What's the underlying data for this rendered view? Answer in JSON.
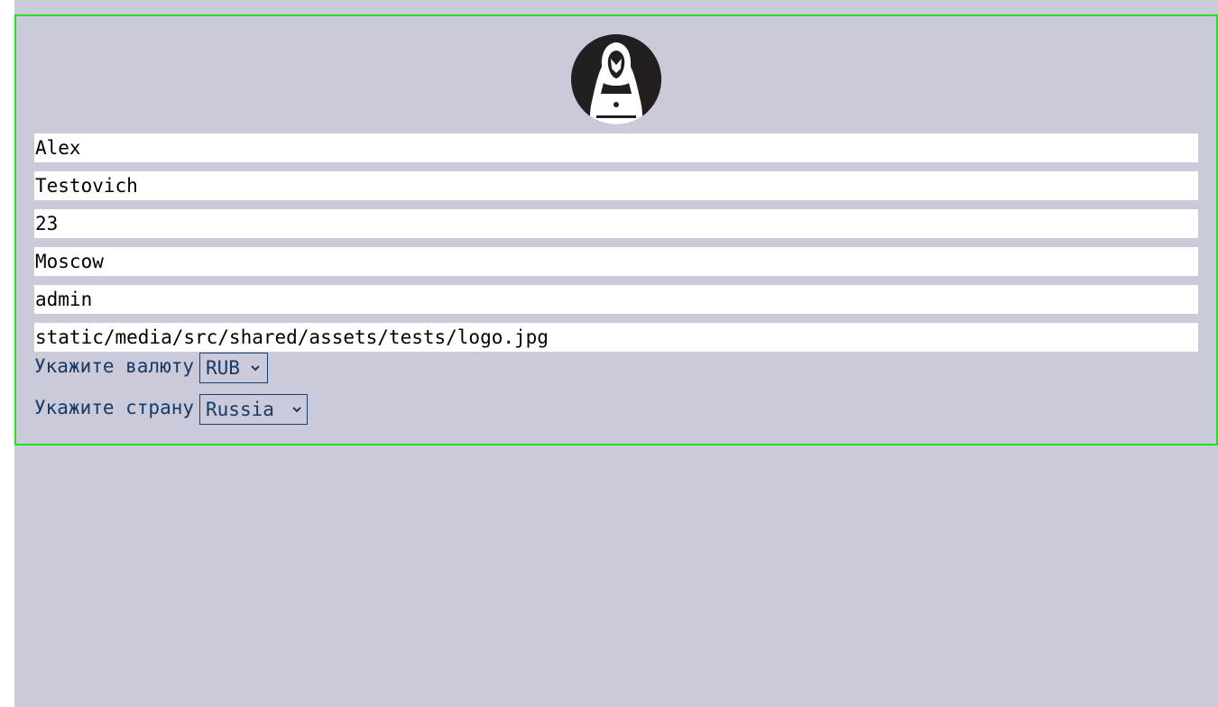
{
  "profile": {
    "first_name": "Alex",
    "last_name": "Testovich",
    "age": "23",
    "city": "Moscow",
    "role": "admin",
    "avatar_path": "static/media/src/shared/assets/tests/logo.jpg"
  },
  "currency": {
    "label": "Укажите валюту",
    "selected": "RUB"
  },
  "country": {
    "label": "Укажите страну",
    "selected": "Russia"
  },
  "colors": {
    "page_background": "#cbcadb",
    "card_border": "#22e022",
    "label_text": "#163a66"
  },
  "icons": {
    "avatar": "hacker-avatar-icon",
    "dropdown": "chevron-down-icon"
  }
}
